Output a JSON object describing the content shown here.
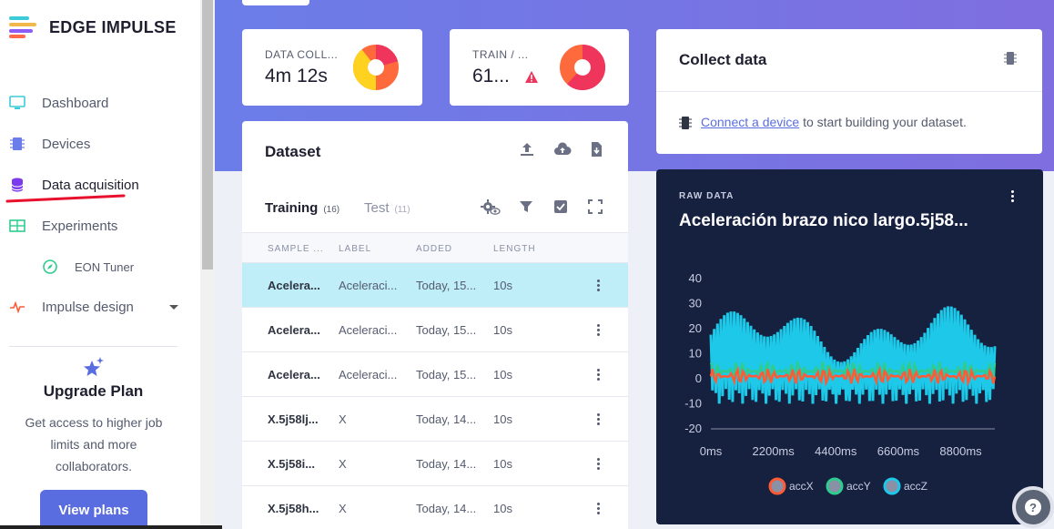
{
  "brand": {
    "name": "EDGE IMPULSE"
  },
  "sidebar": {
    "items": [
      {
        "label": "Dashboard",
        "icon": "monitor-icon"
      },
      {
        "label": "Devices",
        "icon": "chip-icon"
      },
      {
        "label": "Data acquisition",
        "icon": "database-icon"
      },
      {
        "label": "Experiments",
        "icon": "table-icon"
      },
      {
        "label": "EON Tuner",
        "icon": "compass-icon"
      },
      {
        "label": "Impulse design",
        "icon": "pulse-icon"
      }
    ],
    "upgrade": {
      "title": "Upgrade Plan",
      "description": "Get access to higher job limits and more collaborators.",
      "button": "View plans"
    }
  },
  "stats": {
    "data_collected": {
      "label": "DATA COLL...",
      "value": "4m 12s"
    },
    "train_test": {
      "label": "TRAIN / ...",
      "value": "61..."
    }
  },
  "dataset": {
    "title": "Dataset",
    "tabs": [
      {
        "label": "Training",
        "count": "(16)"
      },
      {
        "label": "Test",
        "count": "(11)"
      }
    ],
    "columns": [
      "SAMPLE ...",
      "LABEL",
      "ADDED",
      "LENGTH"
    ],
    "rows": [
      {
        "name": "Acelera...",
        "label": "Aceleraci...",
        "added": "Today, 15...",
        "length": "10s"
      },
      {
        "name": "Acelera...",
        "label": "Aceleraci...",
        "added": "Today, 15...",
        "length": "10s"
      },
      {
        "name": "Acelera...",
        "label": "Aceleraci...",
        "added": "Today, 15...",
        "length": "10s"
      },
      {
        "name": "X.5j58lj...",
        "label": "X",
        "added": "Today, 14...",
        "length": "10s"
      },
      {
        "name": "X.5j58i...",
        "label": "X",
        "added": "Today, 14...",
        "length": "10s"
      },
      {
        "name": "X.5j58h...",
        "label": "X",
        "added": "Today, 14...",
        "length": "10s"
      }
    ]
  },
  "collect": {
    "title": "Collect data",
    "link": "Connect a device",
    "text": " to start building your dataset."
  },
  "raw": {
    "label": "RAW DATA",
    "title": "Aceleración brazo nico largo.5j58..."
  },
  "chart_data": {
    "type": "line",
    "x_ticks": [
      "0ms",
      "2200ms",
      "4400ms",
      "6600ms",
      "8800ms"
    ],
    "y_ticks": [
      40,
      30,
      20,
      10,
      0,
      -10,
      -20
    ],
    "ylim": [
      -20,
      40
    ],
    "xlim": [
      0,
      10000
    ],
    "series": [
      {
        "name": "accX",
        "color": "#ff5a36",
        "center": 1,
        "amp": 3
      },
      {
        "name": "accY",
        "color": "#2ecc8f",
        "center": 3,
        "amp": 4
      },
      {
        "name": "accZ",
        "color": "#1ec8e8",
        "center": 5,
        "amp": 18
      }
    ]
  },
  "colors": {
    "accent": "#5a6de0",
    "selected_row": "#bfeef8",
    "dark_card": "#16203f"
  }
}
